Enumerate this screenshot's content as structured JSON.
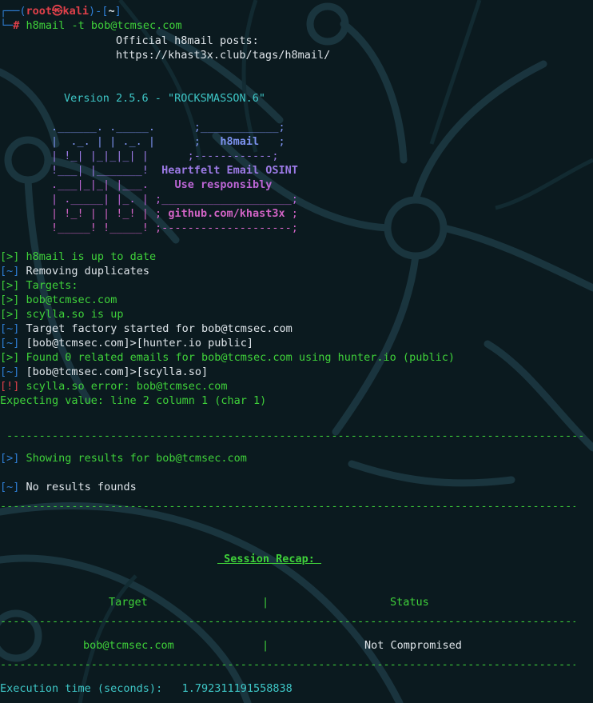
{
  "prompt": {
    "user": "root",
    "at": "㉿",
    "host": "kali",
    "dir": "~",
    "hash": "#",
    "command": "h8mail -t",
    "command_arg": "bob@tcmsec.com"
  },
  "posts": {
    "title": "Official h8mail posts:",
    "url": "https://khast3x.club/tags/h8mail/"
  },
  "version": "Version 2.5.6 - \"ROCKSMASSON.6\"",
  "banner": {
    "name": "h8mail",
    "tagline": "Heartfelt Email OSINT",
    "tagline2": "Use responsibly",
    "github": "github.com/khast3x"
  },
  "log": [
    {
      "tag": "[>]",
      "text": "h8mail is up to date",
      "color": "green"
    },
    {
      "tag": "[~]",
      "text": "Removing duplicates",
      "color": "white"
    },
    {
      "tag": "[>]",
      "text": "Targets:",
      "color": "green"
    },
    {
      "tag": "[>]",
      "text": "bob@tcmsec.com",
      "color": "green"
    },
    {
      "tag": "[>]",
      "text": "scylla.so is up",
      "color": "green"
    },
    {
      "tag": "[~]",
      "text": "Target factory started for bob@tcmsec.com",
      "color": "white"
    },
    {
      "tag": "[~]",
      "text": "[bob@tcmsec.com]>[hunter.io public]",
      "color": "white"
    },
    {
      "tag": "[>]",
      "text": "Found 0 related emails for bob@tcmsec.com using hunter.io (public)",
      "color": "green"
    },
    {
      "tag": "[~]",
      "text": "[bob@tcmsec.com]>[scylla.so]",
      "color": "white"
    },
    {
      "tag": "[!]",
      "text": "scylla.so error: bob@tcmsec.com",
      "color": "green"
    }
  ],
  "error_detail": "Expecting value: line 2 column 1 (char 1)",
  "showing": {
    "tag": "[>]",
    "text": "Showing results for bob@tcmsec.com"
  },
  "no_results": {
    "tag": "[~]",
    "text": "No results founds"
  },
  "recap": {
    "title": " Session Recap: ",
    "col_target": "Target",
    "col_sep": "|",
    "col_status": "Status",
    "row_target": "bob@tcmsec.com",
    "row_status": "Not Compromised"
  },
  "exec": {
    "label": "Execution time (seconds):",
    "value": "1.792311191558838"
  },
  "colors": {
    "background": "#0b1a1f",
    "green": "#3fd13a",
    "blue": "#2f7fd6",
    "red": "#e0404a",
    "cyan": "#3ec7c7"
  }
}
